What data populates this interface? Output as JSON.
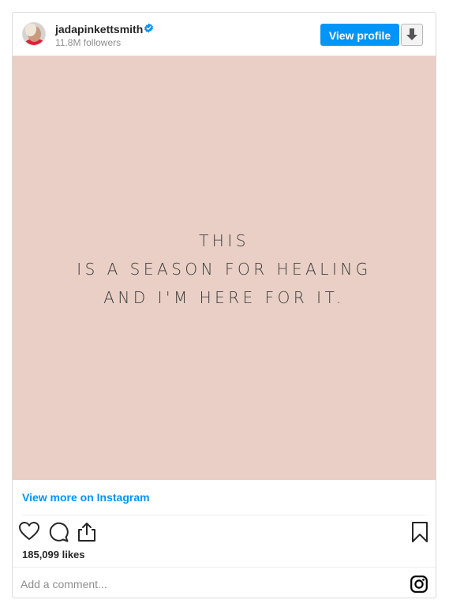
{
  "header": {
    "username": "jadapinkettsmith",
    "followers": "11.8M followers",
    "view_profile_label": "View profile"
  },
  "post": {
    "image_background": "#e9cfc5",
    "quote_lines": [
      "THIS",
      "IS A SEASON FOR HEALING",
      "AND I'M HERE FOR IT."
    ]
  },
  "footer": {
    "view_more_label": "View more on Instagram",
    "likes": "185,099 likes",
    "comment_placeholder": "Add a comment..."
  },
  "icons": {
    "verified": "verified-badge-icon",
    "download": "download-icon",
    "like": "heart-icon",
    "comment": "comment-icon",
    "share": "share-icon",
    "save": "bookmark-icon",
    "instagram": "instagram-logo-icon"
  },
  "colors": {
    "accent": "#0095f6",
    "text_primary": "#262626",
    "text_secondary": "#8e8e8e",
    "border": "#dbdbdb"
  }
}
